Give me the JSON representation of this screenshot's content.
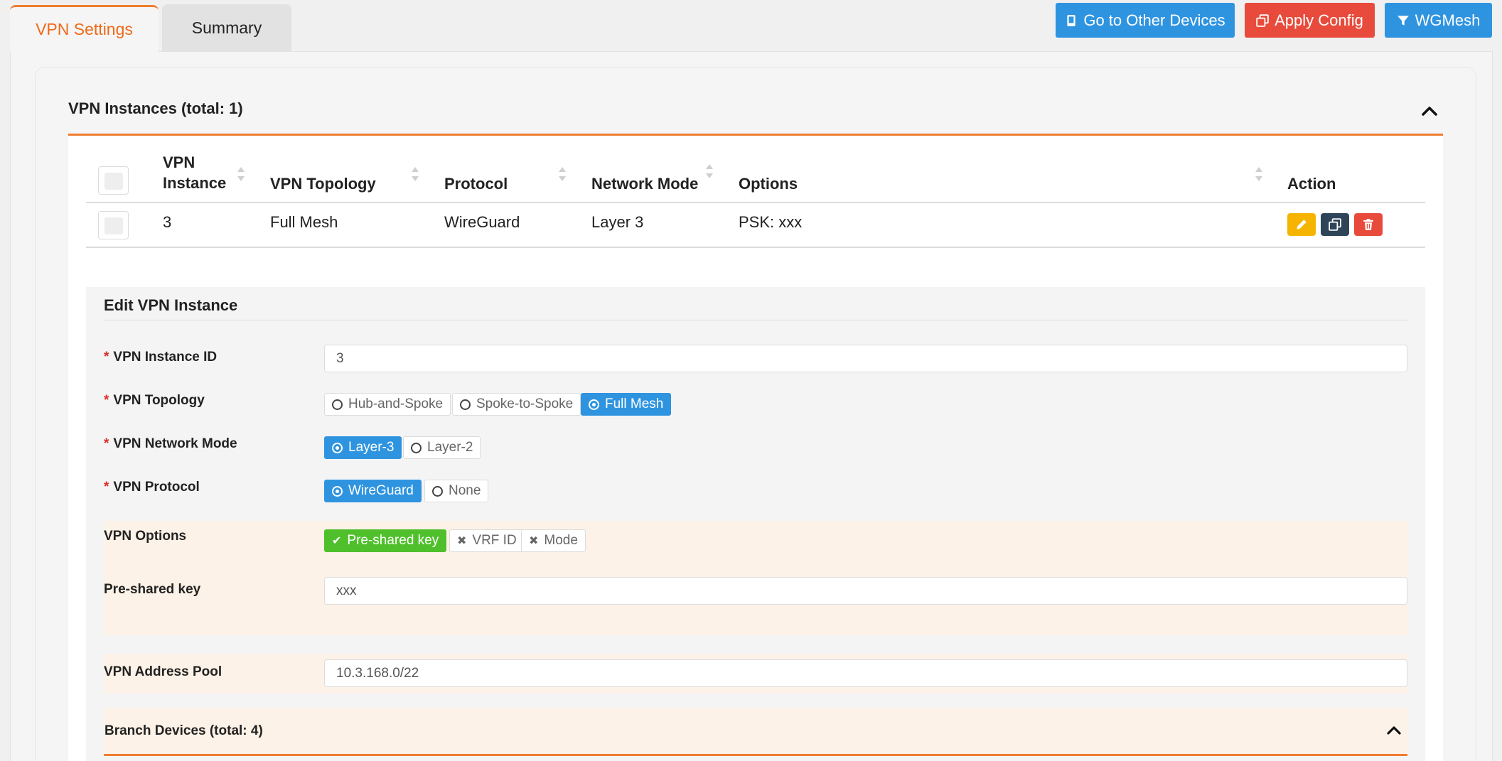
{
  "tabs": [
    {
      "label": "VPN Settings",
      "active": true
    },
    {
      "label": "Summary",
      "active": false
    }
  ],
  "toolbar": {
    "other_devices": "Go to Other Devices",
    "apply_config": "Apply Config",
    "wgmesh": "WGMesh"
  },
  "instances": {
    "title": "VPN Instances (total: 1)",
    "columns": [
      "VPN Instance",
      "VPN Topology",
      "Protocol",
      "Network Mode",
      "Options",
      "Action"
    ],
    "col_instance_line1": "VPN",
    "col_instance_line2": "Instance",
    "rows": [
      {
        "instance": "3",
        "topology": "Full Mesh",
        "protocol": "WireGuard",
        "network_mode": "Layer 3",
        "options": "PSK: xxx"
      }
    ]
  },
  "edit": {
    "title": "Edit VPN Instance",
    "instance_id_label": "VPN Instance ID",
    "instance_id_value": "3",
    "topology_label": "VPN Topology",
    "topology_options": [
      "Hub-and-Spoke",
      "Spoke-to-Spoke",
      "Full Mesh"
    ],
    "topology_selected": "Full Mesh",
    "network_mode_label": "VPN Network Mode",
    "network_mode_options": [
      "Layer-3",
      "Layer-2"
    ],
    "network_mode_selected": "Layer-3",
    "protocol_label": "VPN Protocol",
    "protocol_options": [
      "WireGuard",
      "None"
    ],
    "protocol_selected": "WireGuard",
    "options_label": "VPN Options",
    "options": [
      {
        "label": "Pre-shared key",
        "enabled": true
      },
      {
        "label": "VRF ID",
        "enabled": false
      },
      {
        "label": "Mode",
        "enabled": false
      }
    ],
    "psk_label": "Pre-shared key",
    "psk_value": "xxx",
    "address_pool_label": "VPN Address Pool",
    "address_pool_value": "10.3.168.0/22",
    "branch_title": "Branch Devices (total: 4)"
  },
  "colors": {
    "accent_orange": "#f07d30",
    "primary_blue": "#2f94e0",
    "danger_red": "#e84b3c",
    "warning_yellow": "#f5b400",
    "dark_slate": "#2e4458",
    "success_green": "#4fc02c"
  }
}
